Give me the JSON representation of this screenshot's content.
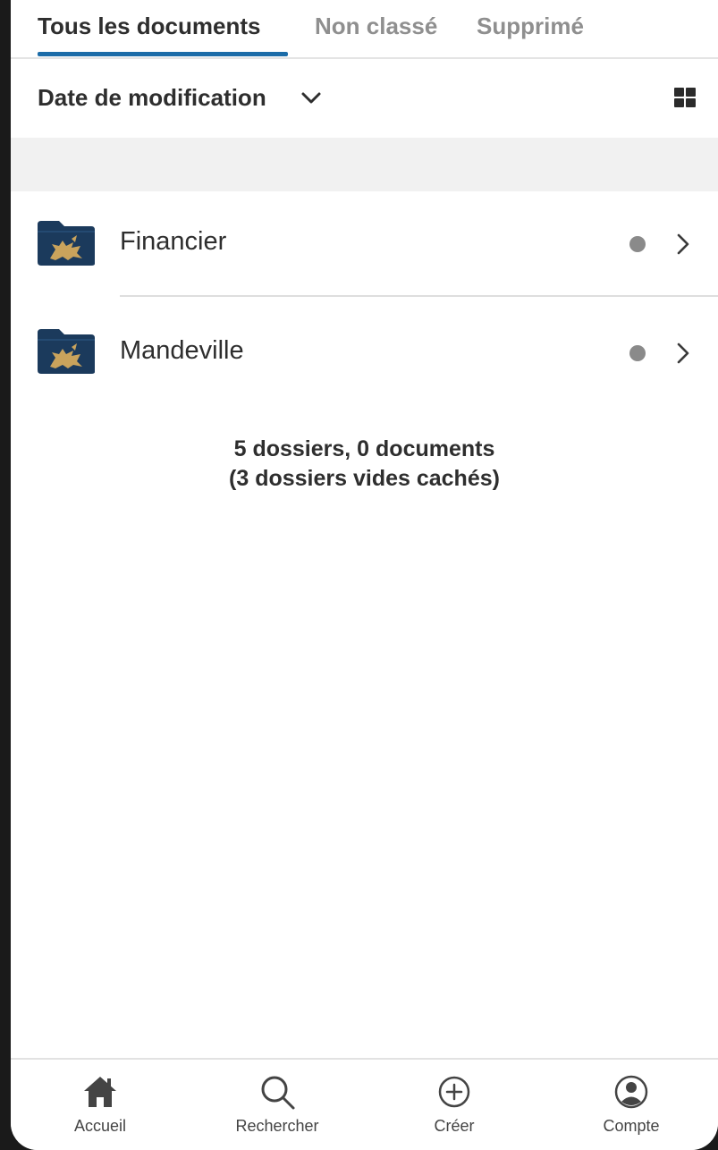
{
  "tabs": [
    {
      "label": "Tous les documents",
      "active": true
    },
    {
      "label": "Non classé",
      "active": false
    },
    {
      "label": "Supprimé",
      "active": false
    }
  ],
  "sort": {
    "label": "Date de modification",
    "chevron_icon": "chevron-down-icon",
    "view_icon": "grid-view-icon"
  },
  "folders": [
    {
      "name": "Financier",
      "icon": "folder-lion-icon",
      "status_color": "#8a8a8a"
    },
    {
      "name": "Mandeville",
      "icon": "folder-lion-icon",
      "status_color": "#8a8a8a"
    }
  ],
  "summary": {
    "line1": "5 dossiers, 0 documents",
    "line2": "(3 dossiers vides cachés)"
  },
  "bottom_nav": [
    {
      "label": "Accueil",
      "icon": "home-icon"
    },
    {
      "label": "Rechercher",
      "icon": "search-icon"
    },
    {
      "label": "Créer",
      "icon": "plus-circle-icon"
    },
    {
      "label": "Compte",
      "icon": "account-icon"
    }
  ],
  "colors": {
    "accent": "#1c6ca8",
    "folder": "#1b3a5c",
    "emblem": "#c9a35c",
    "text": "#2e2e2e",
    "muted": "#8f8f8f"
  }
}
